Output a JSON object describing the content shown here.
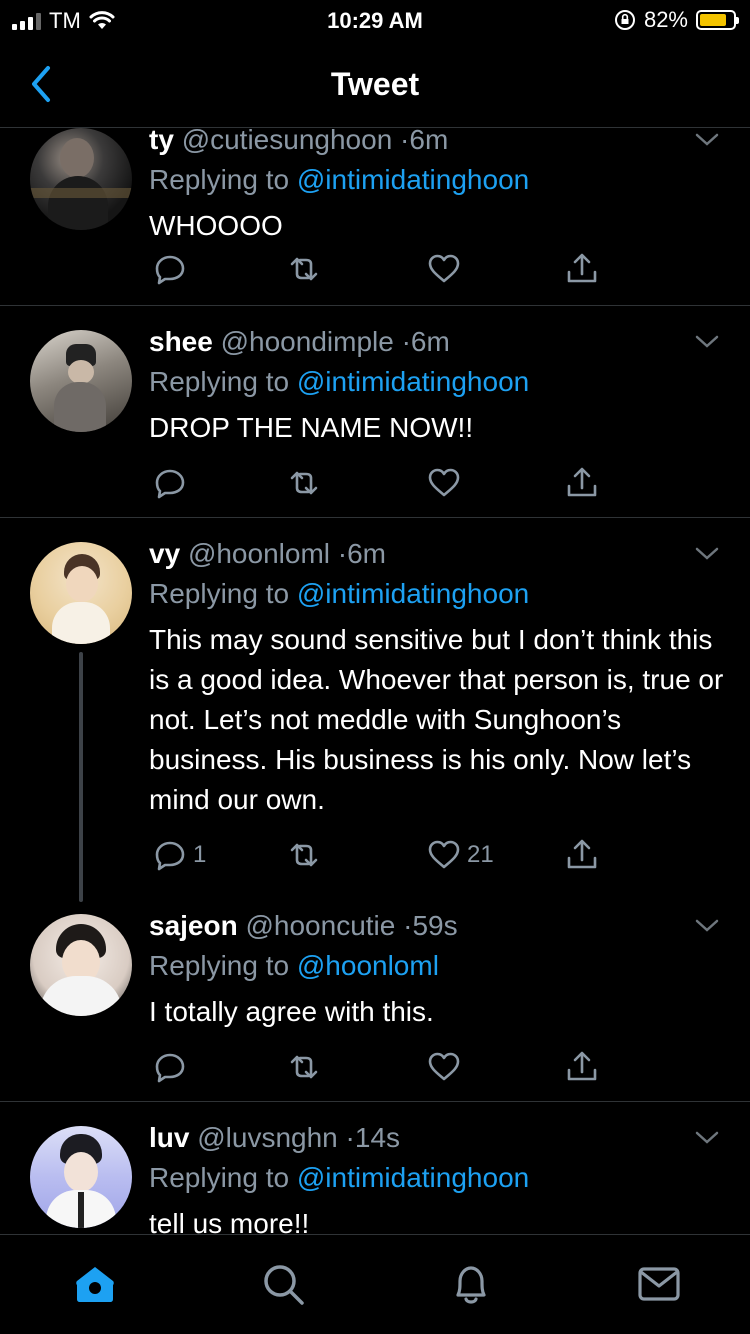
{
  "status_bar": {
    "carrier": "TM",
    "time": "10:29 AM",
    "battery_percent": "82%",
    "battery_level": 0.82,
    "icons": [
      "signal-icon",
      "wifi-icon",
      "orientation-lock-icon",
      "battery-icon"
    ]
  },
  "nav": {
    "title": "Tweet",
    "back_icon": "chevron-left-icon"
  },
  "colors": {
    "accent": "#1da1f2",
    "muted": "#8b98a5",
    "divider": "#2f3336",
    "battery": "#f4c400"
  },
  "tweets": [
    {
      "name": "ty",
      "handle": "@cutiesunghoon",
      "time": "6m",
      "reply_prefix": "Replying to",
      "reply_to": "@intimidatinghoon",
      "text": "WHOOOO",
      "reply_count": "",
      "like_count": ""
    },
    {
      "name": "shee",
      "handle": "@hoondimple",
      "time": "6m",
      "reply_prefix": "Replying to",
      "reply_to": "@intimidatinghoon",
      "text": "DROP THE NAME NOW!!",
      "reply_count": "",
      "like_count": ""
    },
    {
      "name": "vy",
      "handle": "@hoonloml",
      "time": "6m",
      "reply_prefix": "Replying to",
      "reply_to": "@intimidatinghoon",
      "text": "This may sound sensitive but I don’t think this is a good idea. Whoever that person is, true or not. Let’s not meddle with Sunghoon’s business. His business is his only. Now let’s mind our own.",
      "reply_count": "1",
      "like_count": "21"
    },
    {
      "name": "sajeon",
      "handle": "@hooncutie",
      "time": "59s",
      "reply_prefix": "Replying to",
      "reply_to": "@hoonloml",
      "text": "I totally agree with this.",
      "reply_count": "",
      "like_count": ""
    },
    {
      "name": "luv",
      "handle": "@luvsnghn",
      "time": "14s",
      "reply_prefix": "Replying to",
      "reply_to": "@intimidatinghoon",
      "text": "tell us more!!",
      "reply_count": "",
      "like_count": ""
    }
  ],
  "tab_bar": {
    "items": [
      "home-icon",
      "search-icon",
      "notifications-icon",
      "messages-icon"
    ],
    "active": "home-icon"
  }
}
